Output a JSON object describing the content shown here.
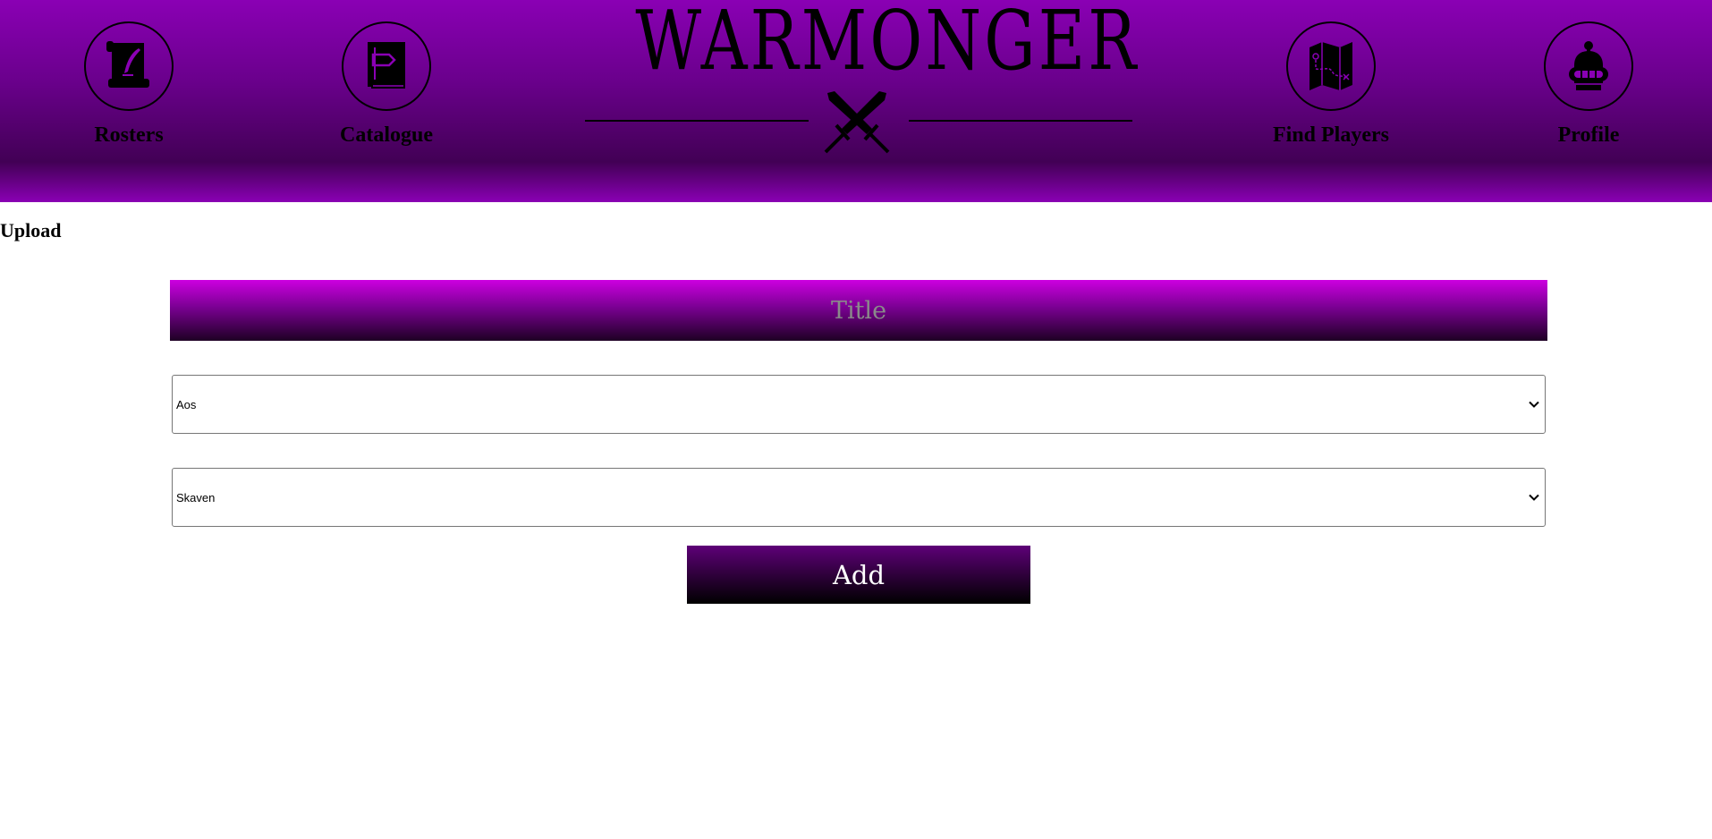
{
  "nav": {
    "rosters": "Rosters",
    "catalogue": "Catalogue",
    "find_players": "Find Players",
    "profile": "Profile"
  },
  "logo": {
    "text": "WARMONGER"
  },
  "upload": {
    "label": "Upload"
  },
  "form": {
    "title_placeholder": "Title",
    "system_select": {
      "selected": "Aos"
    },
    "faction_select": {
      "selected": "Skaven"
    },
    "add_label": "Add"
  },
  "colors": {
    "header_purple": "#8a00b4",
    "title_bar_top": "#cc00e0",
    "button_dark": "#2a0035"
  }
}
